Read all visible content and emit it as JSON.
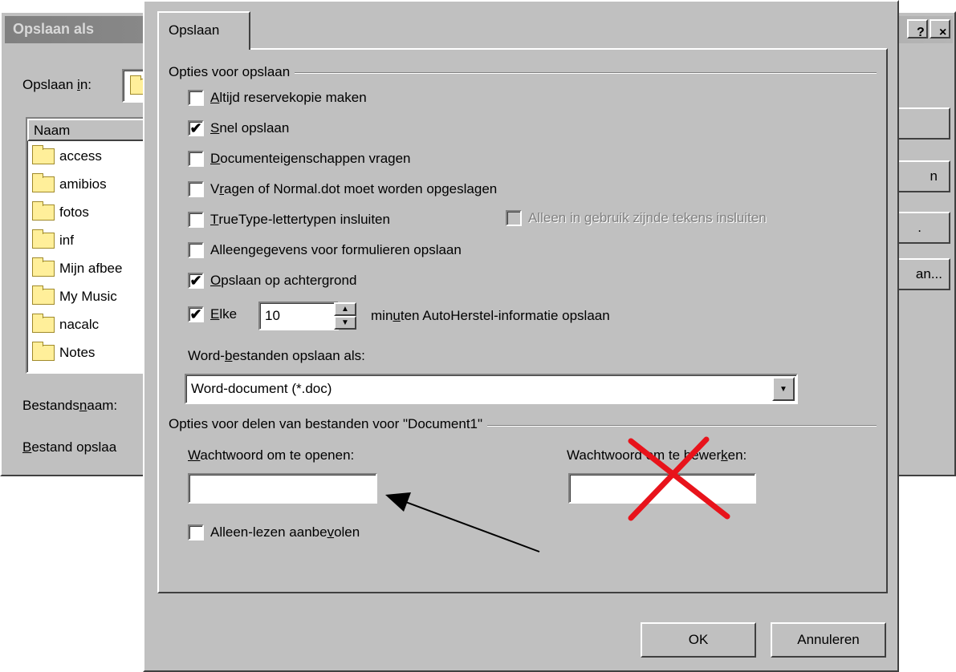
{
  "background_window": {
    "title": "Opslaan als",
    "help_button": "?",
    "close_button": "×",
    "save_in_label_prefix": "Opslaan ",
    "save_in_label_mnemonic": "i",
    "save_in_label_suffix": "n:",
    "list_header": "Naam",
    "files": [
      "access",
      "amibios",
      "fotos",
      "inf",
      "Mijn afbee",
      "My Music",
      "nacalc",
      "Notes"
    ],
    "filename_label_prefix": "Bestands",
    "filename_label_mnemonic": "n",
    "filename_label_suffix": "aam:",
    "filetype_label_mnemonic": "B",
    "filetype_label_suffix": "estand opslaa",
    "right_buttons": [
      "",
      "n",
      ".",
      "an..."
    ]
  },
  "dialog": {
    "tab_label": "Opslaan",
    "save_options_group": "Opties voor opslaan",
    "options": [
      {
        "mn": "A",
        "rest": "ltijd reservekopie maken",
        "pre": "",
        "checked": false
      },
      {
        "mn": "S",
        "rest": "nel opslaan",
        "pre": "",
        "checked": true
      },
      {
        "mn": "D",
        "rest": "ocumenteigenschappen vragen",
        "pre": "",
        "checked": false
      },
      {
        "mn": "r",
        "rest": "agen of Normal.dot moet worden opgeslagen",
        "pre": "V",
        "checked": false
      },
      {
        "mn": "T",
        "rest": "rueType-lettertypen insluiten",
        "pre": "",
        "checked": false
      },
      {
        "mn": "g",
        "rest": "egevens voor formulieren opslaan",
        "pre": "Alleen ",
        "checked": false
      },
      {
        "mn": "O",
        "rest": "pslaan op achtergrond",
        "pre": "",
        "checked": true
      }
    ],
    "embed_used_only": "Alleen in gebruik zijnde tekens insluiten",
    "autorecover": {
      "checked": true,
      "label_mn": "E",
      "label_rest": "lke",
      "minutes": "10",
      "suffix_pre": "min",
      "suffix_mn": "u",
      "suffix_rest": "ten AutoHerstel-informatie opslaan"
    },
    "save_as_label_pre": "Word-",
    "save_as_label_mn": "b",
    "save_as_label_rest": "estanden opslaan als:",
    "save_as_value": "Word-document (*.doc)",
    "sharing_group": "Opties voor delen van bestanden voor \"Document1\"",
    "open_password_label_mn": "W",
    "open_password_label_rest": "achtwoord om te openen:",
    "open_password_value": "",
    "modify_password_label_pre": "Wachtwoord om te bewer",
    "modify_password_label_mn": "k",
    "modify_password_label_rest": "en:",
    "modify_password_value": "",
    "readonly_pre": "Alleen-lezen aanbe",
    "readonly_mn": "v",
    "readonly_rest": "olen",
    "readonly_checked": false,
    "ok_button": "OK",
    "cancel_button": "Annuleren"
  },
  "colors": {
    "dialog_face": "#c0c0c0",
    "cross_annotation": "#e8131b",
    "arrow_annotation": "#000000",
    "folder_yellow": "#ffef9a"
  }
}
